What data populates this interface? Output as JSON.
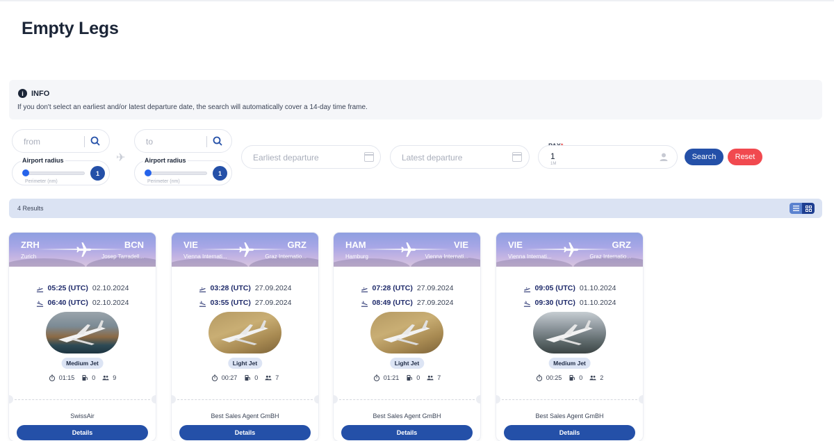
{
  "page": {
    "title": "Empty Legs"
  },
  "info": {
    "label": "INFO",
    "text": "If you don't select an earliest and/or latest departure date, the search will automatically cover a 14-day time frame."
  },
  "search": {
    "from": {
      "placeholder": "from",
      "radius_label": "Airport radius",
      "radius_sub": "Perimeter (nm)",
      "radius_value": "1"
    },
    "to": {
      "placeholder": "to",
      "radius_label": "Airport radius",
      "radius_sub": "Perimeter (nm)",
      "radius_value": "1"
    },
    "earliest_placeholder": "Earliest departure",
    "latest_placeholder": "Latest departure",
    "pax": {
      "label": "PAX",
      "required_mark": "*",
      "value": "1",
      "sub": "1M"
    },
    "search_label": "Search",
    "reset_label": "Reset"
  },
  "results": {
    "count_label": "4 Results",
    "view_modes": [
      "list",
      "grid"
    ],
    "active_view": "grid"
  },
  "colors": {
    "primary": "#2450a8",
    "danger": "#f1494f",
    "results_bar": "#dbe3f3",
    "badge": "#dce4f4"
  },
  "cards": [
    {
      "from_code": "ZRH",
      "from_city": "Zurich",
      "to_code": "BCN",
      "to_city": "Josep Tarradell...",
      "dep_time": "05:25 (UTC)",
      "dep_date": "02.10.2024",
      "arr_time": "06:40 (UTC)",
      "arr_date": "02.10.2024",
      "category": "Medium Jet",
      "duration": "01:15",
      "fuel_stops": "0",
      "seats": "9",
      "operator": "SwissAir",
      "details_label": "Details"
    },
    {
      "from_code": "VIE",
      "from_city": "Vienna Internati...",
      "to_code": "GRZ",
      "to_city": "Graz Internatio...",
      "dep_time": "03:28 (UTC)",
      "dep_date": "27.09.2024",
      "arr_time": "03:55 (UTC)",
      "arr_date": "27.09.2024",
      "category": "Light Jet",
      "duration": "00:27",
      "fuel_stops": "0",
      "seats": "7",
      "operator": "Best Sales Agent GmBH",
      "details_label": "Details"
    },
    {
      "from_code": "HAM",
      "from_city": "Hamburg",
      "to_code": "VIE",
      "to_city": "Vienna Internati...",
      "dep_time": "07:28 (UTC)",
      "dep_date": "27.09.2024",
      "arr_time": "08:49 (UTC)",
      "arr_date": "27.09.2024",
      "category": "Light Jet",
      "duration": "01:21",
      "fuel_stops": "0",
      "seats": "7",
      "operator": "Best Sales Agent GmBH",
      "details_label": "Details"
    },
    {
      "from_code": "VIE",
      "from_city": "Vienna Internati...",
      "to_code": "GRZ",
      "to_city": "Graz Internatio...",
      "dep_time": "09:05 (UTC)",
      "dep_date": "01.10.2024",
      "arr_time": "09:30 (UTC)",
      "arr_date": "01.10.2024",
      "category": "Medium Jet",
      "duration": "00:25",
      "fuel_stops": "0",
      "seats": "2",
      "operator": "Best Sales Agent GmBH",
      "details_label": "Details"
    }
  ]
}
